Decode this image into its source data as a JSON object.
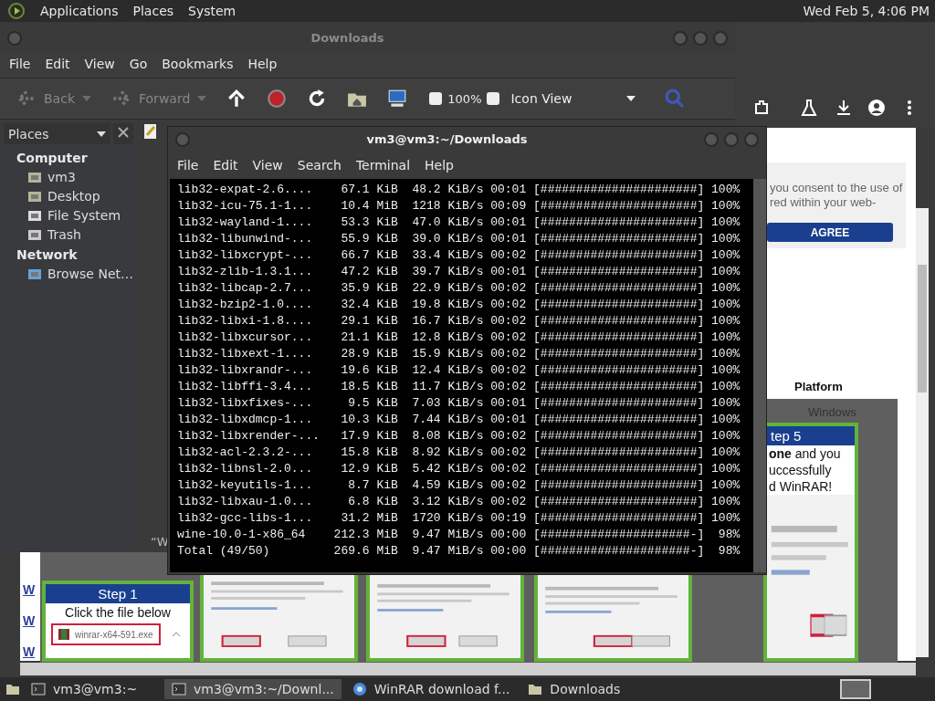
{
  "top_panel": {
    "menus": [
      "Applications",
      "Places",
      "System"
    ],
    "clock": "Wed Feb 5,  4:06 PM"
  },
  "browser": {
    "cookie_lines": [
      "you consent to the use of",
      "red within your web-"
    ],
    "agree_button": "AGREE",
    "column_header": "Platform",
    "cell": "Windows",
    "links": [
      "W",
      "W",
      "W"
    ],
    "step1": {
      "title": "Step 1",
      "text": "Click the file below",
      "file": "winrar-x64-591.exe"
    },
    "step5": {
      "title": "tep 5",
      "lines": [
        "**one** and you",
        "uccessfully",
        "d WinRAR!"
      ]
    }
  },
  "file_manager": {
    "title": "Downloads",
    "menu": [
      "File",
      "Edit",
      "View",
      "Go",
      "Bookmarks",
      "Help"
    ],
    "toolbar": [
      {
        "kind": "back",
        "label": "Back",
        "disabled": true
      },
      {
        "kind": "forward",
        "label": "Forward",
        "disabled": true
      },
      {
        "kind": "up",
        "disabled": false
      },
      {
        "kind": "stop",
        "disabled": false
      },
      {
        "kind": "reload",
        "disabled": false
      },
      {
        "kind": "home",
        "disabled": false
      },
      {
        "kind": "computer",
        "disabled": false
      }
    ],
    "zoom": "100%",
    "view": "Icon View",
    "status_text": "“W",
    "sidebar": {
      "title": "Places",
      "sections": [
        {
          "title": "Computer",
          "items": [
            {
              "kind": "home",
              "label": "vm3"
            },
            {
              "kind": "desktop",
              "label": "Desktop"
            },
            {
              "kind": "drive",
              "label": "File System"
            },
            {
              "kind": "trash",
              "label": "Trash"
            }
          ]
        },
        {
          "title": "Network",
          "items": [
            {
              "kind": "network",
              "label": "Browse Net…"
            }
          ]
        }
      ]
    }
  },
  "terminal": {
    "title": "vm3@vm3:~/Downloads",
    "menu": [
      "File",
      "Edit",
      "View",
      "Search",
      "Terminal",
      "Help"
    ],
    "rows": [
      [
        "lib32-expat-2.6....",
        "67.1 KiB",
        "48.2 KiB/s",
        "00:01",
        "[######################]",
        "100%"
      ],
      [
        "lib32-icu-75.1-1...",
        "10.4 MiB",
        "1218 KiB/s",
        "00:09",
        "[######################]",
        "100%"
      ],
      [
        "lib32-wayland-1....",
        "53.3 KiB",
        "47.0 KiB/s",
        "00:01",
        "[######################]",
        "100%"
      ],
      [
        "lib32-libunwind-...",
        "55.9 KiB",
        "39.0 KiB/s",
        "00:01",
        "[######################]",
        "100%"
      ],
      [
        "lib32-libxcrypt-...",
        "66.7 KiB",
        "33.4 KiB/s",
        "00:02",
        "[######################]",
        "100%"
      ],
      [
        "lib32-zlib-1.3.1...",
        "47.2 KiB",
        "39.7 KiB/s",
        "00:01",
        "[######################]",
        "100%"
      ],
      [
        "lib32-libcap-2.7...",
        "35.9 KiB",
        "22.9 KiB/s",
        "00:02",
        "[######################]",
        "100%"
      ],
      [
        "lib32-bzip2-1.0....",
        "32.4 KiB",
        "19.8 KiB/s",
        "00:02",
        "[######################]",
        "100%"
      ],
      [
        "lib32-libxi-1.8....",
        "29.1 KiB",
        "16.7 KiB/s",
        "00:02",
        "[######################]",
        "100%"
      ],
      [
        "lib32-libxcursor...",
        "21.1 KiB",
        "12.8 KiB/s",
        "00:02",
        "[######################]",
        "100%"
      ],
      [
        "lib32-libxext-1....",
        "28.9 KiB",
        "15.9 KiB/s",
        "00:02",
        "[######################]",
        "100%"
      ],
      [
        "lib32-libxrandr-...",
        "19.6 KiB",
        "12.4 KiB/s",
        "00:02",
        "[######################]",
        "100%"
      ],
      [
        "lib32-libffi-3.4...",
        "18.5 KiB",
        "11.7 KiB/s",
        "00:02",
        "[######################]",
        "100%"
      ],
      [
        "lib32-libxfixes-...",
        "9.5 KiB",
        "7.03 KiB/s",
        "00:01",
        "[######################]",
        "100%"
      ],
      [
        "lib32-libxdmcp-1...",
        "10.3 KiB",
        "7.44 KiB/s",
        "00:01",
        "[######################]",
        "100%"
      ],
      [
        "lib32-libxrender-...",
        "17.9 KiB",
        "8.08 KiB/s",
        "00:02",
        "[######################]",
        "100%"
      ],
      [
        "lib32-acl-2.3.2-...",
        "15.8 KiB",
        "8.92 KiB/s",
        "00:02",
        "[######################]",
        "100%"
      ],
      [
        "lib32-libnsl-2.0...",
        "12.9 KiB",
        "5.42 KiB/s",
        "00:02",
        "[######################]",
        "100%"
      ],
      [
        "lib32-keyutils-1...",
        "8.7 KiB",
        "4.59 KiB/s",
        "00:02",
        "[######################]",
        "100%"
      ],
      [
        "lib32-libxau-1.0...",
        "6.8 KiB",
        "3.12 KiB/s",
        "00:02",
        "[######################]",
        "100%"
      ],
      [
        "lib32-gcc-libs-1...",
        "31.2 MiB",
        "1720 KiB/s",
        "00:19",
        "[######################]",
        "100%"
      ],
      [
        "wine-10.0-1-x86_64",
        "212.3 MiB",
        "9.47 MiB/s",
        "00:00",
        "[#####################-]",
        "98%"
      ],
      [
        "Total (49/50)",
        "269.6 MiB",
        "9.47 MiB/s",
        "00:00",
        "[#####################-]",
        "98%"
      ]
    ]
  },
  "taskbar": {
    "items": [
      {
        "kind": "terminal",
        "label": "vm3@vm3:~",
        "selected": false
      },
      {
        "kind": "terminal",
        "label": "vm3@vm3:~/Downl...",
        "selected": true
      },
      {
        "kind": "browser",
        "label": "WinRAR download f...",
        "selected": false
      },
      {
        "kind": "folder",
        "label": "Downloads",
        "selected": false
      }
    ]
  }
}
